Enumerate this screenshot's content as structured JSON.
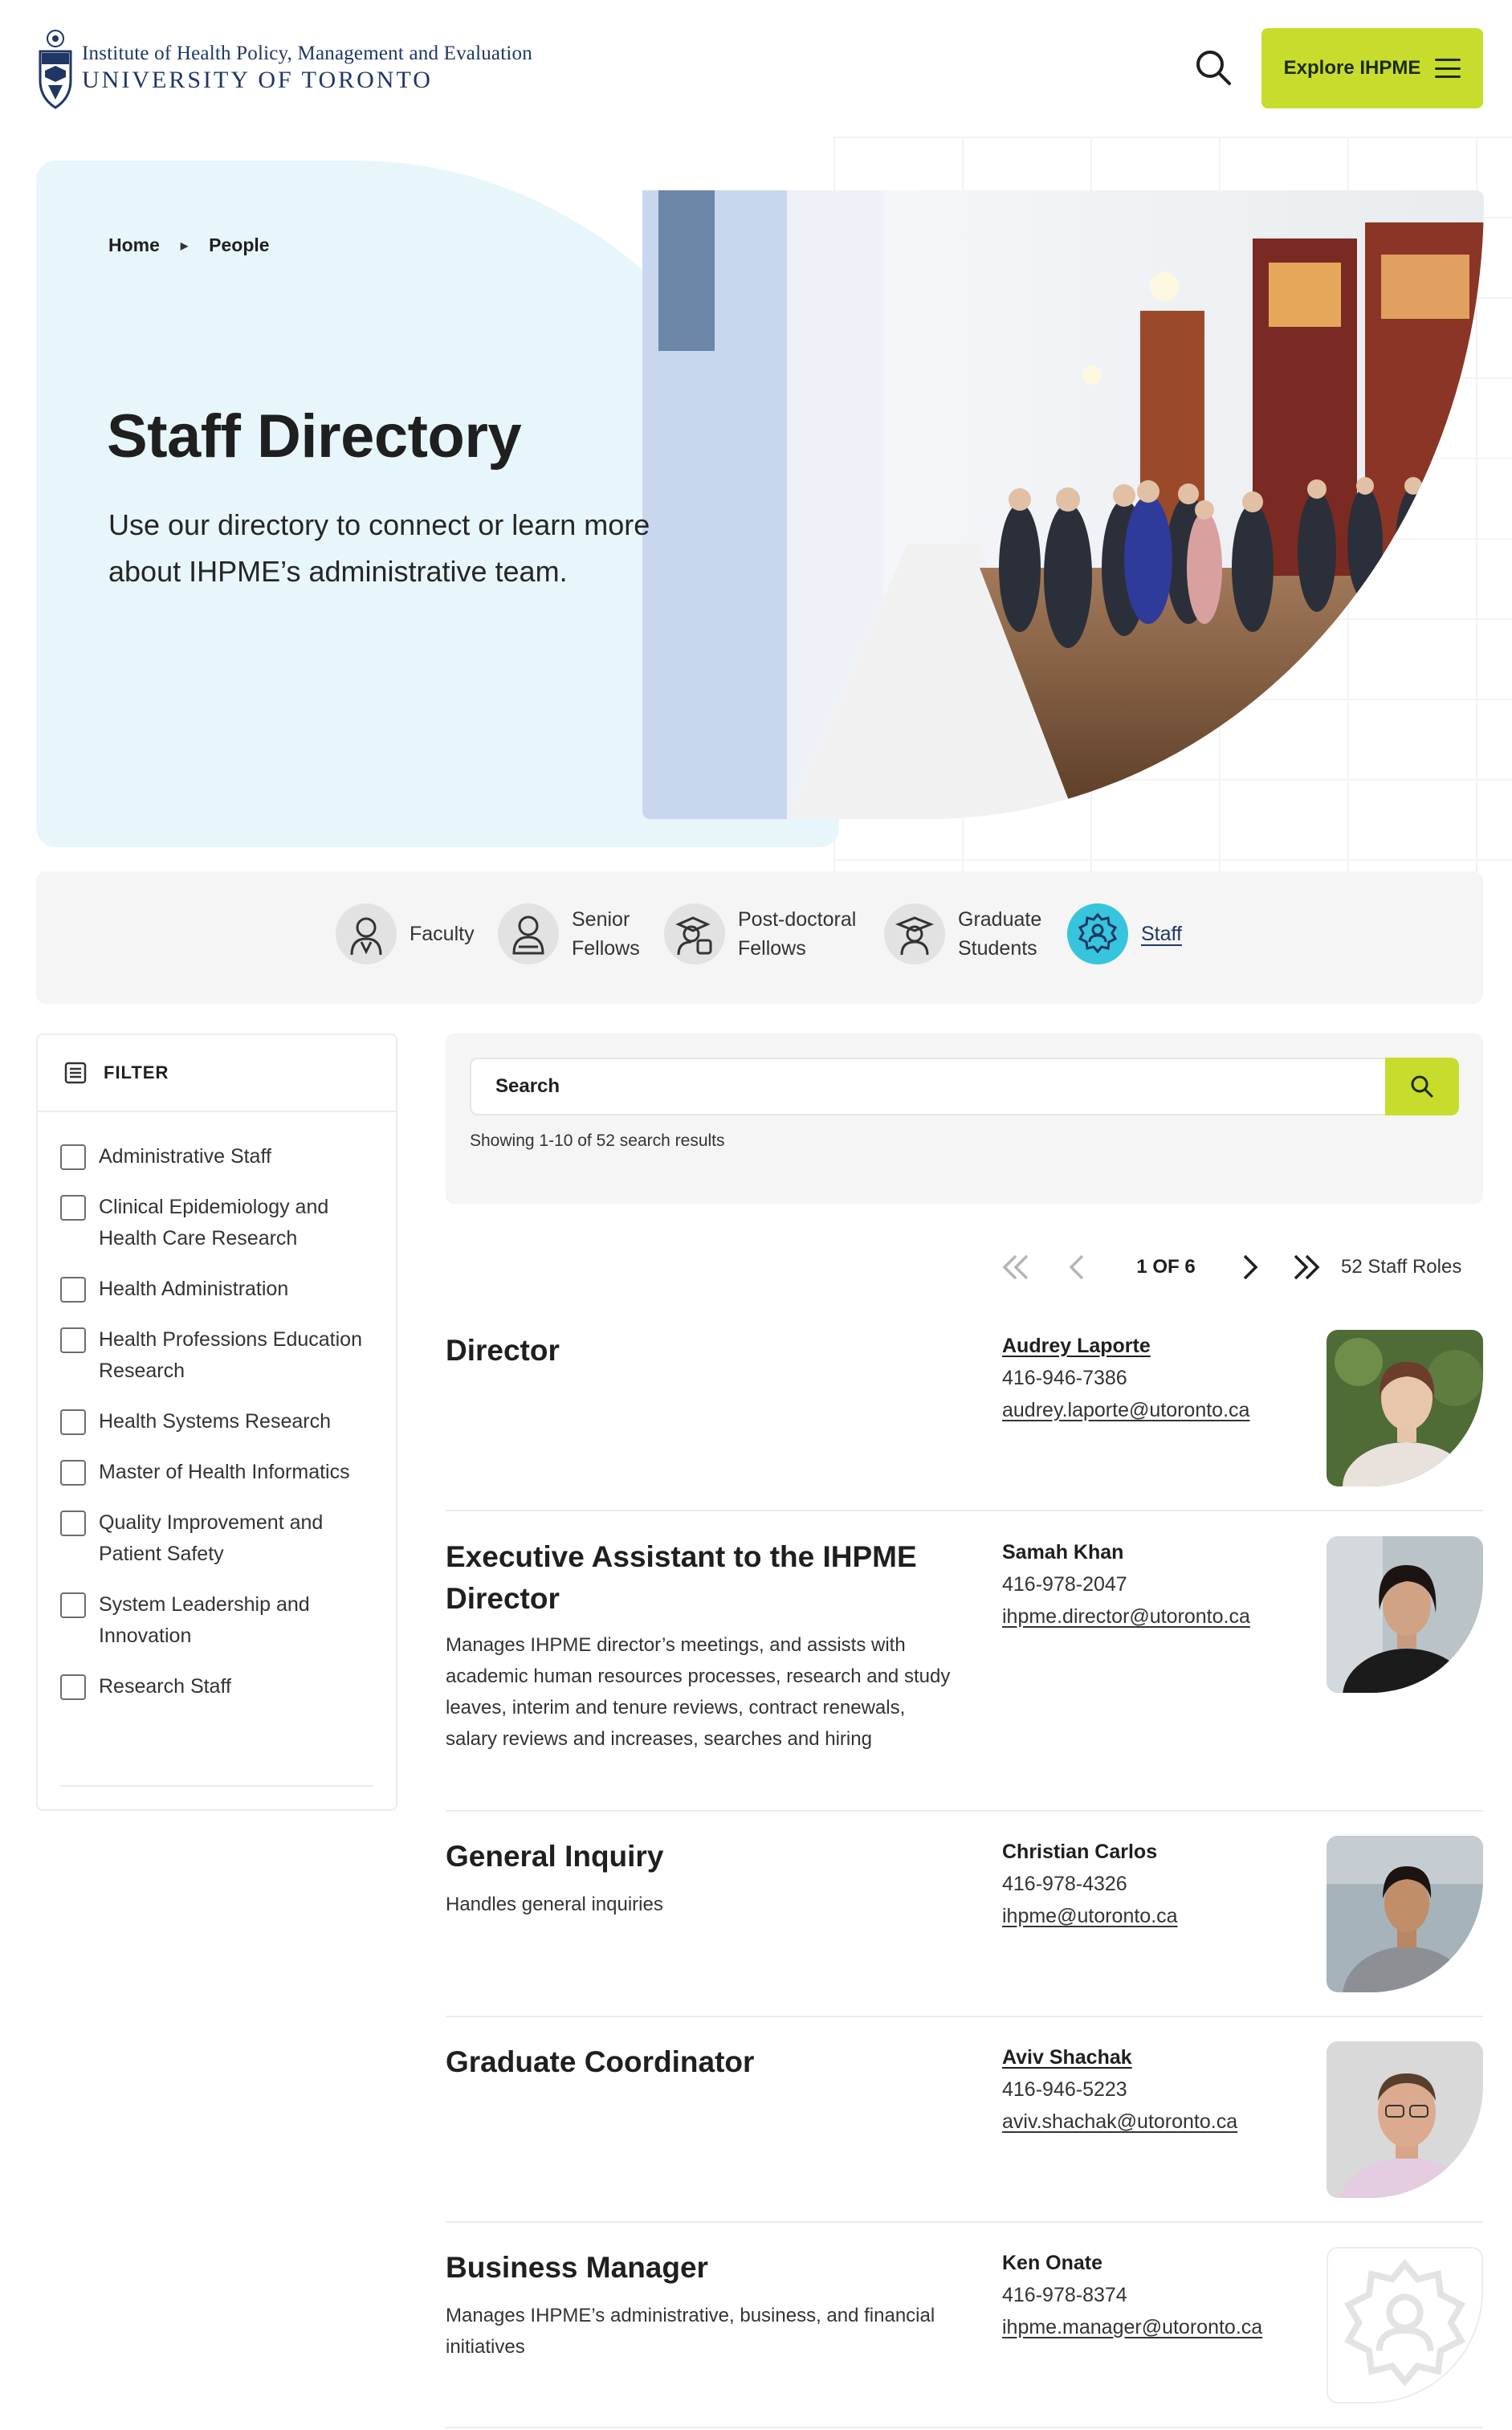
{
  "header": {
    "logo_line1": "Institute of Health Policy, Management and Evaluation",
    "logo_line2": "UNIVERSITY OF TORONTO",
    "explore_label": "Explore IHPME"
  },
  "breadcrumb": {
    "home": "Home",
    "current": "People"
  },
  "hero": {
    "title": "Staff Directory",
    "description": "Use our directory to connect or learn more about IHPME’s administrative team."
  },
  "categories": [
    {
      "label": "Faculty",
      "icon": "faculty-icon"
    },
    {
      "label": "Senior Fellows",
      "icon": "senior-fellow-icon"
    },
    {
      "label": "Post-doctoral Fellows",
      "icon": "postdoc-icon"
    },
    {
      "label": "Graduate Students",
      "icon": "graduate-icon"
    },
    {
      "label": "Staff",
      "icon": "gear-person-icon",
      "active": true
    }
  ],
  "filter": {
    "heading": "FILTER",
    "options": [
      "Administrative Staff",
      "Clinical Epidemiology and Health Care Research",
      "Health Administration",
      "Health Professions Education Research",
      "Health Systems Research",
      "Master of Health Informatics",
      "Quality Improvement and Patient Safety",
      "System Leadership and Innovation",
      "Research Staff"
    ]
  },
  "search": {
    "placeholder": "Search",
    "results_text": "Showing 1-10 of 52 search results"
  },
  "pagination": {
    "label": "1 OF 6",
    "total": "52 Staff Roles"
  },
  "staff": [
    {
      "role": "Director",
      "description": "",
      "name": "Audrey Laporte",
      "name_link": true,
      "phone": "416-946-7386",
      "email": "audrey.laporte@utoronto.ca"
    },
    {
      "role": "Executive Assistant to the IHPME Director",
      "description": "Manages IHPME director’s meetings, and assists with academic human resources processes, research and study leaves, interim and tenure reviews, contract renewals, salary reviews and increases, searches and hiring",
      "name": "Samah Khan",
      "name_link": false,
      "phone": "416-978-2047",
      "email": "ihpme.director@utoronto.ca"
    },
    {
      "role": "General Inquiry",
      "description": "Handles general inquiries",
      "name": "Christian Carlos",
      "name_link": false,
      "phone": "416-978-4326",
      "email": "ihpme@utoronto.ca"
    },
    {
      "role": "Graduate Coordinator",
      "description": "",
      "name": "Aviv Shachak",
      "name_link": true,
      "phone": "416-946-5223",
      "email": "aviv.shachak@utoronto.ca"
    },
    {
      "role": "Business Manager",
      "description": "Manages IHPME’s administrative, business, and financial initiatives",
      "name": "Ken Onate",
      "name_link": false,
      "phone": "416-978-8374",
      "email": "ihpme.manager@utoronto.ca"
    }
  ],
  "colors": {
    "accent_lime": "#c8dc2d",
    "hero_bg": "#e7f6fa",
    "active_cyan": "#36c5dd",
    "navy": "#1e3765"
  }
}
